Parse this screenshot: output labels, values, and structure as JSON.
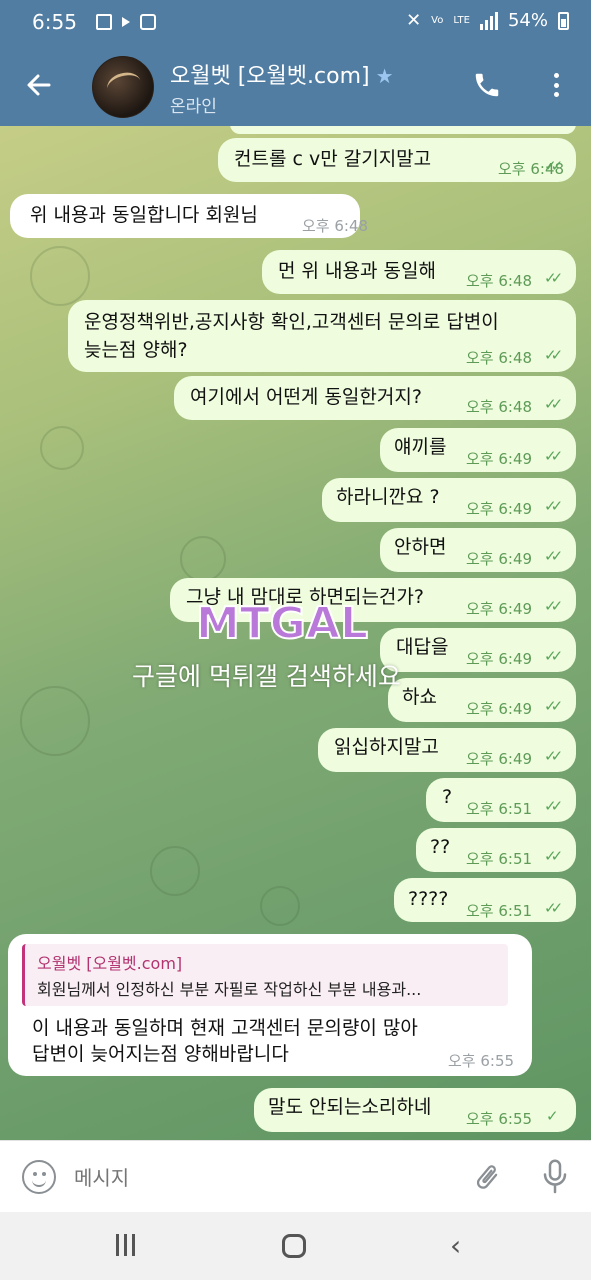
{
  "status_bar": {
    "time": "6:55",
    "network": "LTE",
    "battery": "54%"
  },
  "header": {
    "title": "오월벳 [오월벳.com]",
    "status": "온라인",
    "accent": "#517da2"
  },
  "messages": [
    {
      "dir": "out",
      "text": "컨트롤 c v만 갈기지말고",
      "time": "오후 6:48",
      "read": true
    },
    {
      "dir": "in",
      "text": "위 내용과 동일합니다 회원님",
      "time": "오후 6:48"
    },
    {
      "dir": "out",
      "text": "먼 위 내용과 동일해",
      "time": "오후 6:48",
      "read": true
    },
    {
      "dir": "out",
      "text_line1": "운영정책위반,공지사항 확인,고객센터 문의로 답변이",
      "text_line2": "늦는점 양해?",
      "time": "오후 6:48",
      "read": true
    },
    {
      "dir": "out",
      "text": "여기에서 어떤게 동일한거지?",
      "time": "오후 6:48",
      "read": true
    },
    {
      "dir": "out",
      "text": "얘끼를",
      "time": "오후 6:49",
      "read": true
    },
    {
      "dir": "out",
      "text": "하라니깐요 ?",
      "time": "오후 6:49",
      "read": true
    },
    {
      "dir": "out",
      "text": "안하면",
      "time": "오후 6:49",
      "read": true
    },
    {
      "dir": "out",
      "text": "그냥 내 맘대로 하면되는건가?",
      "time": "오후 6:49",
      "read": true
    },
    {
      "dir": "out",
      "text": "대답을",
      "time": "오후 6:49",
      "read": true
    },
    {
      "dir": "out",
      "text": "하쇼",
      "time": "오후 6:49",
      "read": true
    },
    {
      "dir": "out",
      "text": "읽십하지말고",
      "time": "오후 6:49",
      "read": true
    },
    {
      "dir": "out",
      "text": "?",
      "time": "오후 6:51",
      "read": true
    },
    {
      "dir": "out",
      "text": "??",
      "time": "오후 6:51",
      "read": true
    },
    {
      "dir": "out",
      "text": "????",
      "time": "오후 6:51",
      "read": true
    },
    {
      "dir": "in",
      "reply_name": "오월벳 [오월벳.com]",
      "reply_text": "회원님께서 인정하신 부분 자필로 작업하신 부분 내용과...",
      "text_line1": "이 내용과 동일하며 현재 고객센터 문의량이 많아",
      "text_line2": "답변이 늦어지는점 양해바랍니다",
      "time": "오후 6:55"
    },
    {
      "dir": "out",
      "text": "말도 안되는소리하네",
      "time": "오후 6:55",
      "read": false
    }
  ],
  "watermark": {
    "logo": "MTGAL",
    "caption": "구글에 먹튀갤 검색하세요"
  },
  "composer": {
    "placeholder": "메시지"
  },
  "icons": [
    "back-arrow-icon",
    "call-icon",
    "more-vert-icon",
    "emoji-icon",
    "attach-icon",
    "mic-icon",
    "check-icon"
  ]
}
